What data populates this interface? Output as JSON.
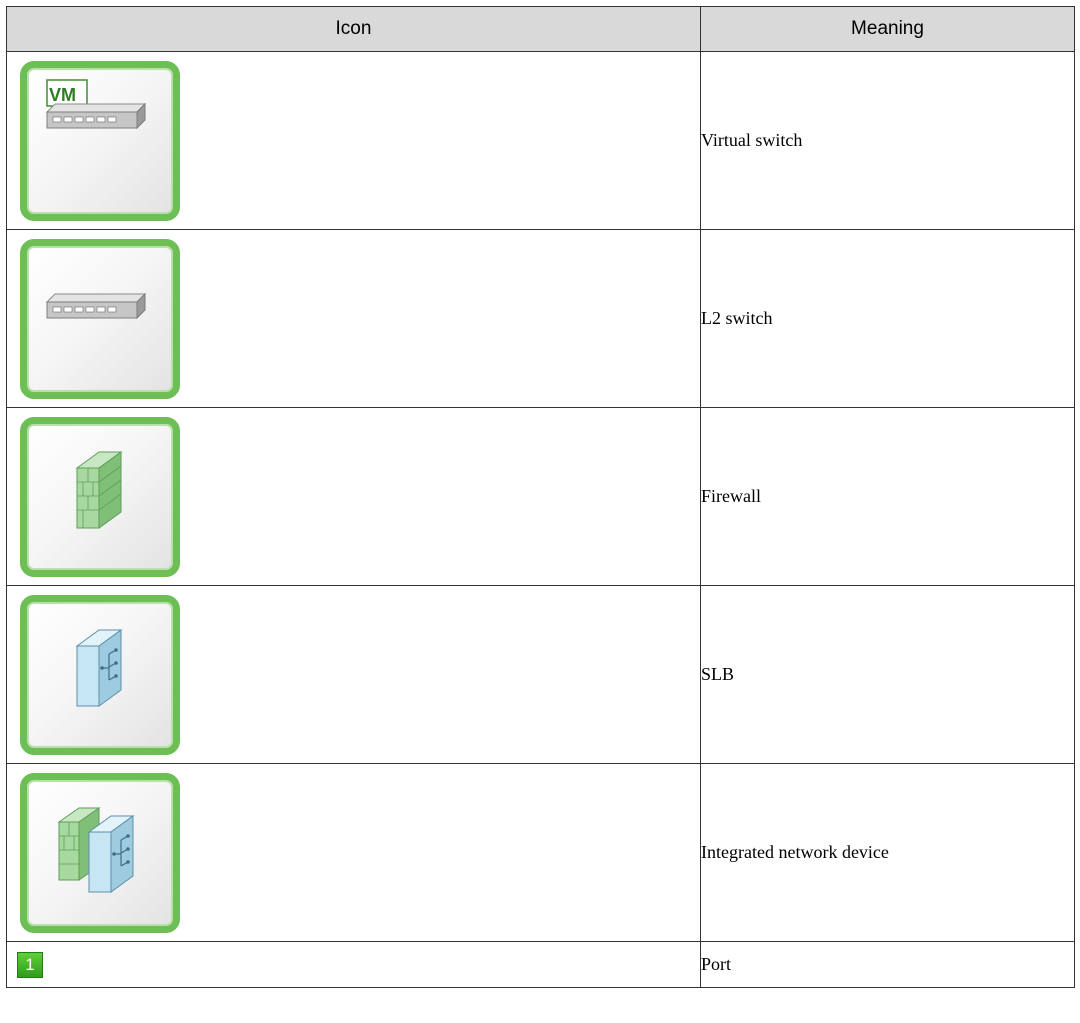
{
  "table": {
    "headers": {
      "icon": "Icon",
      "meaning": "Meaning"
    },
    "rows": [
      {
        "icon": "virtual-switch-icon",
        "icon_label": "VM",
        "meaning": "Virtual switch"
      },
      {
        "icon": "l2-switch-icon",
        "meaning": "L2 switch"
      },
      {
        "icon": "firewall-icon",
        "meaning": "Firewall"
      },
      {
        "icon": "slb-icon",
        "meaning": "SLB"
      },
      {
        "icon": "integrated-network-device-icon",
        "meaning": "Integrated network device"
      },
      {
        "icon": "port-icon",
        "port_number": "1",
        "meaning": "Port"
      }
    ]
  },
  "colors": {
    "frame_green": "#6dbe55",
    "firewall_green": "#9ed39a",
    "slb_blue": "#bfe3f2",
    "port_green": "#3aab22",
    "header_bg": "#d9d9d9"
  }
}
